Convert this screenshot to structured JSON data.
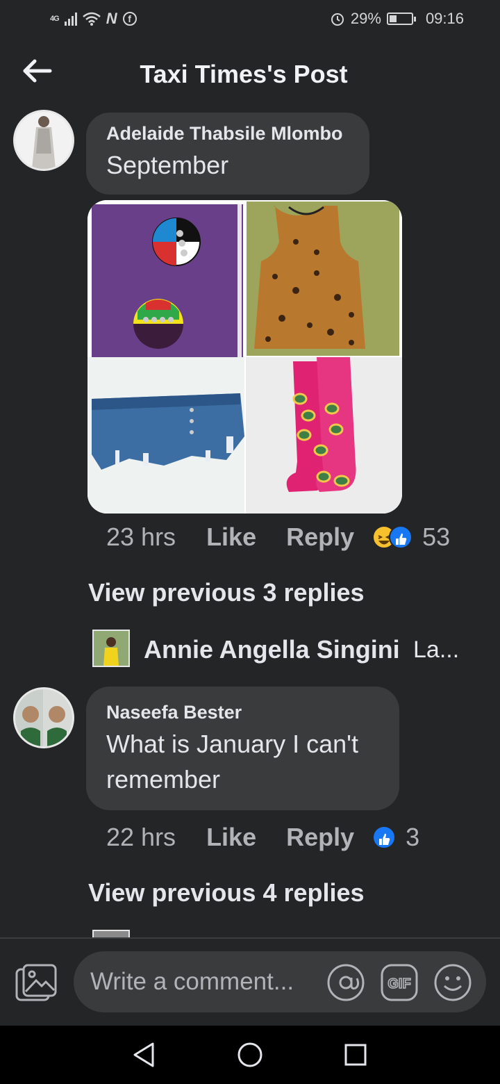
{
  "status_bar": {
    "network": "4G",
    "battery": "29%",
    "time": "09:16"
  },
  "header": {
    "title": "Taxi Times's Post"
  },
  "comments": [
    {
      "author": "Adelaide Thabsile Mlombo",
      "text": "September",
      "time": "23 hrs",
      "like_label": "Like",
      "reply_label": "Reply",
      "reaction_count": "53",
      "view_previous": "View previous 3 replies",
      "latest_reply": {
        "author": "Annie Angella Singini",
        "text": "La..."
      }
    },
    {
      "author": "Naseefa Bester",
      "text_line1": "What is January I can't",
      "text_line2": "remember",
      "time": "22 hrs",
      "like_label": "Like",
      "reply_label": "Reply",
      "reaction_count": "3",
      "view_previous": "View previous 4 replies"
    }
  ],
  "composer": {
    "placeholder": "Write a comment..."
  },
  "colors": {
    "background": "#242527",
    "bubble": "#3a3b3c",
    "like_blue": "#1877f2",
    "haha_yellow": "#f7c02d"
  }
}
